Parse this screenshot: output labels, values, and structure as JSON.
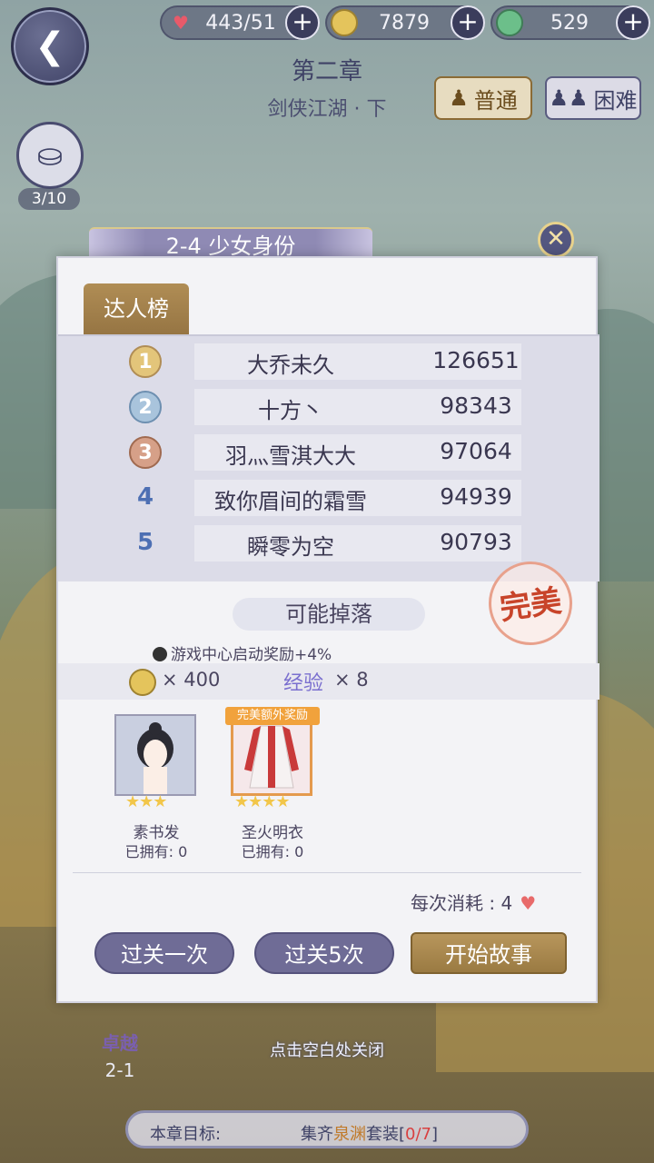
{
  "resources": [
    {
      "icon": "heart-icon",
      "value": "443/51"
    },
    {
      "icon": "coin-icon",
      "value": "7879"
    },
    {
      "icon": "gem-icon",
      "value": "529"
    }
  ],
  "chapter": {
    "title": "第二章",
    "subtitle": "剑侠江湖 · 下"
  },
  "modes": {
    "normal": "普通",
    "hard": "困难"
  },
  "bag": {
    "count": "3/10"
  },
  "stage": {
    "title": "2-4 少女身份"
  },
  "tabs": {
    "rank": "达人榜"
  },
  "ranking": [
    {
      "rank": "1",
      "name": "大乔未久",
      "score": "126651"
    },
    {
      "rank": "2",
      "name": "十方丶",
      "score": "98343"
    },
    {
      "rank": "3",
      "name": "羽灬雪淇大大",
      "score": "97064"
    },
    {
      "rank": "4",
      "name": "致你眉间的霜雪",
      "score": "94939"
    },
    {
      "rank": "5",
      "name": "瞬零为空",
      "score": "90793"
    }
  ],
  "seal": "完美",
  "drops": {
    "title": "可能掉落",
    "bonus": "游戏中心启动奖励+4%",
    "coin": "× 400",
    "exp_label": "经验",
    "exp": "× 8",
    "extra_tag": "完美额外奖励",
    "items": [
      {
        "name": "素书发",
        "owned": "已拥有: 0",
        "stars": "★★★"
      },
      {
        "name": "圣火明衣",
        "owned": "已拥有: 0",
        "stars": "★★★★"
      }
    ]
  },
  "cost": {
    "label": "每次消耗 : 4"
  },
  "buttons": {
    "once": "过关一次",
    "five": "过关5次",
    "start": "开始故事"
  },
  "hint": "点击空白处关闭",
  "node": {
    "name": "卓越",
    "id": "2-1"
  },
  "goal": {
    "label": "本章目标:",
    "prefix": "集齐",
    "highlight": "泉渊",
    "suffix": "套装[",
    "progress": "0/7",
    "end": "]"
  },
  "colors": {
    "accent": "#9a7a42",
    "primary": "#6f6c96",
    "seal": "#c8442a"
  }
}
